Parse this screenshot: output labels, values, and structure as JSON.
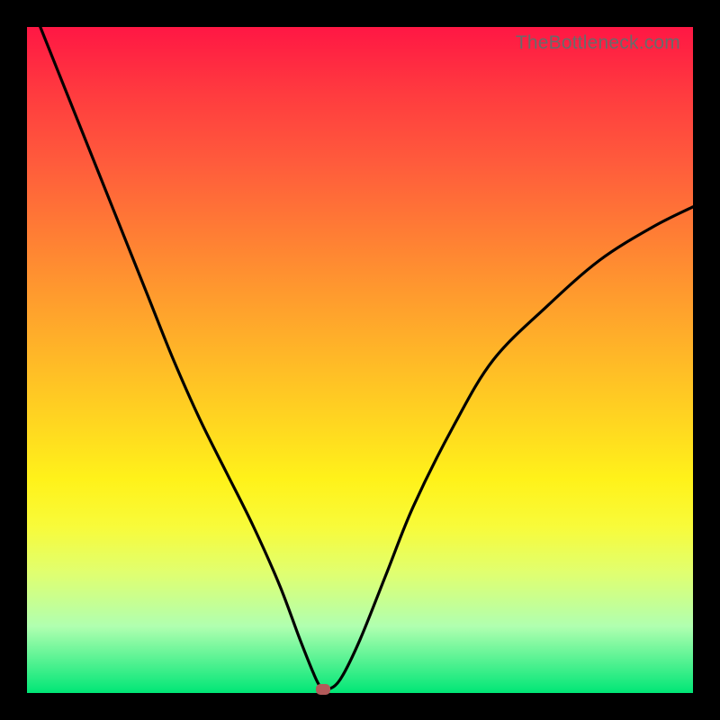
{
  "watermark": "TheBottleneck.com",
  "chart_data": {
    "type": "line",
    "title": "",
    "xlabel": "",
    "ylabel": "",
    "xlim": [
      0,
      100
    ],
    "ylim": [
      0,
      100
    ],
    "series": [
      {
        "name": "bottleneck-curve",
        "x": [
          2,
          6,
          10,
          14,
          18,
          22,
          26,
          30,
          34,
          38,
          41,
          43,
          44,
          45,
          47,
          50,
          54,
          58,
          64,
          70,
          78,
          86,
          94,
          100
        ],
        "values": [
          100,
          90,
          80,
          70,
          60,
          50,
          41,
          33,
          25,
          16,
          8,
          3,
          1,
          0.5,
          2,
          8,
          18,
          28,
          40,
          50,
          58,
          65,
          70,
          73
        ]
      }
    ],
    "marker": {
      "name": "minimum-point",
      "x": 44.5,
      "y": 0.5,
      "color": "#b35a5a"
    },
    "notes": "Curve with V-shape: steep descending left branch, a minimum near x≈44, then rising right branch that levels off. Values are visual estimates; no numeric axis labels visible."
  }
}
